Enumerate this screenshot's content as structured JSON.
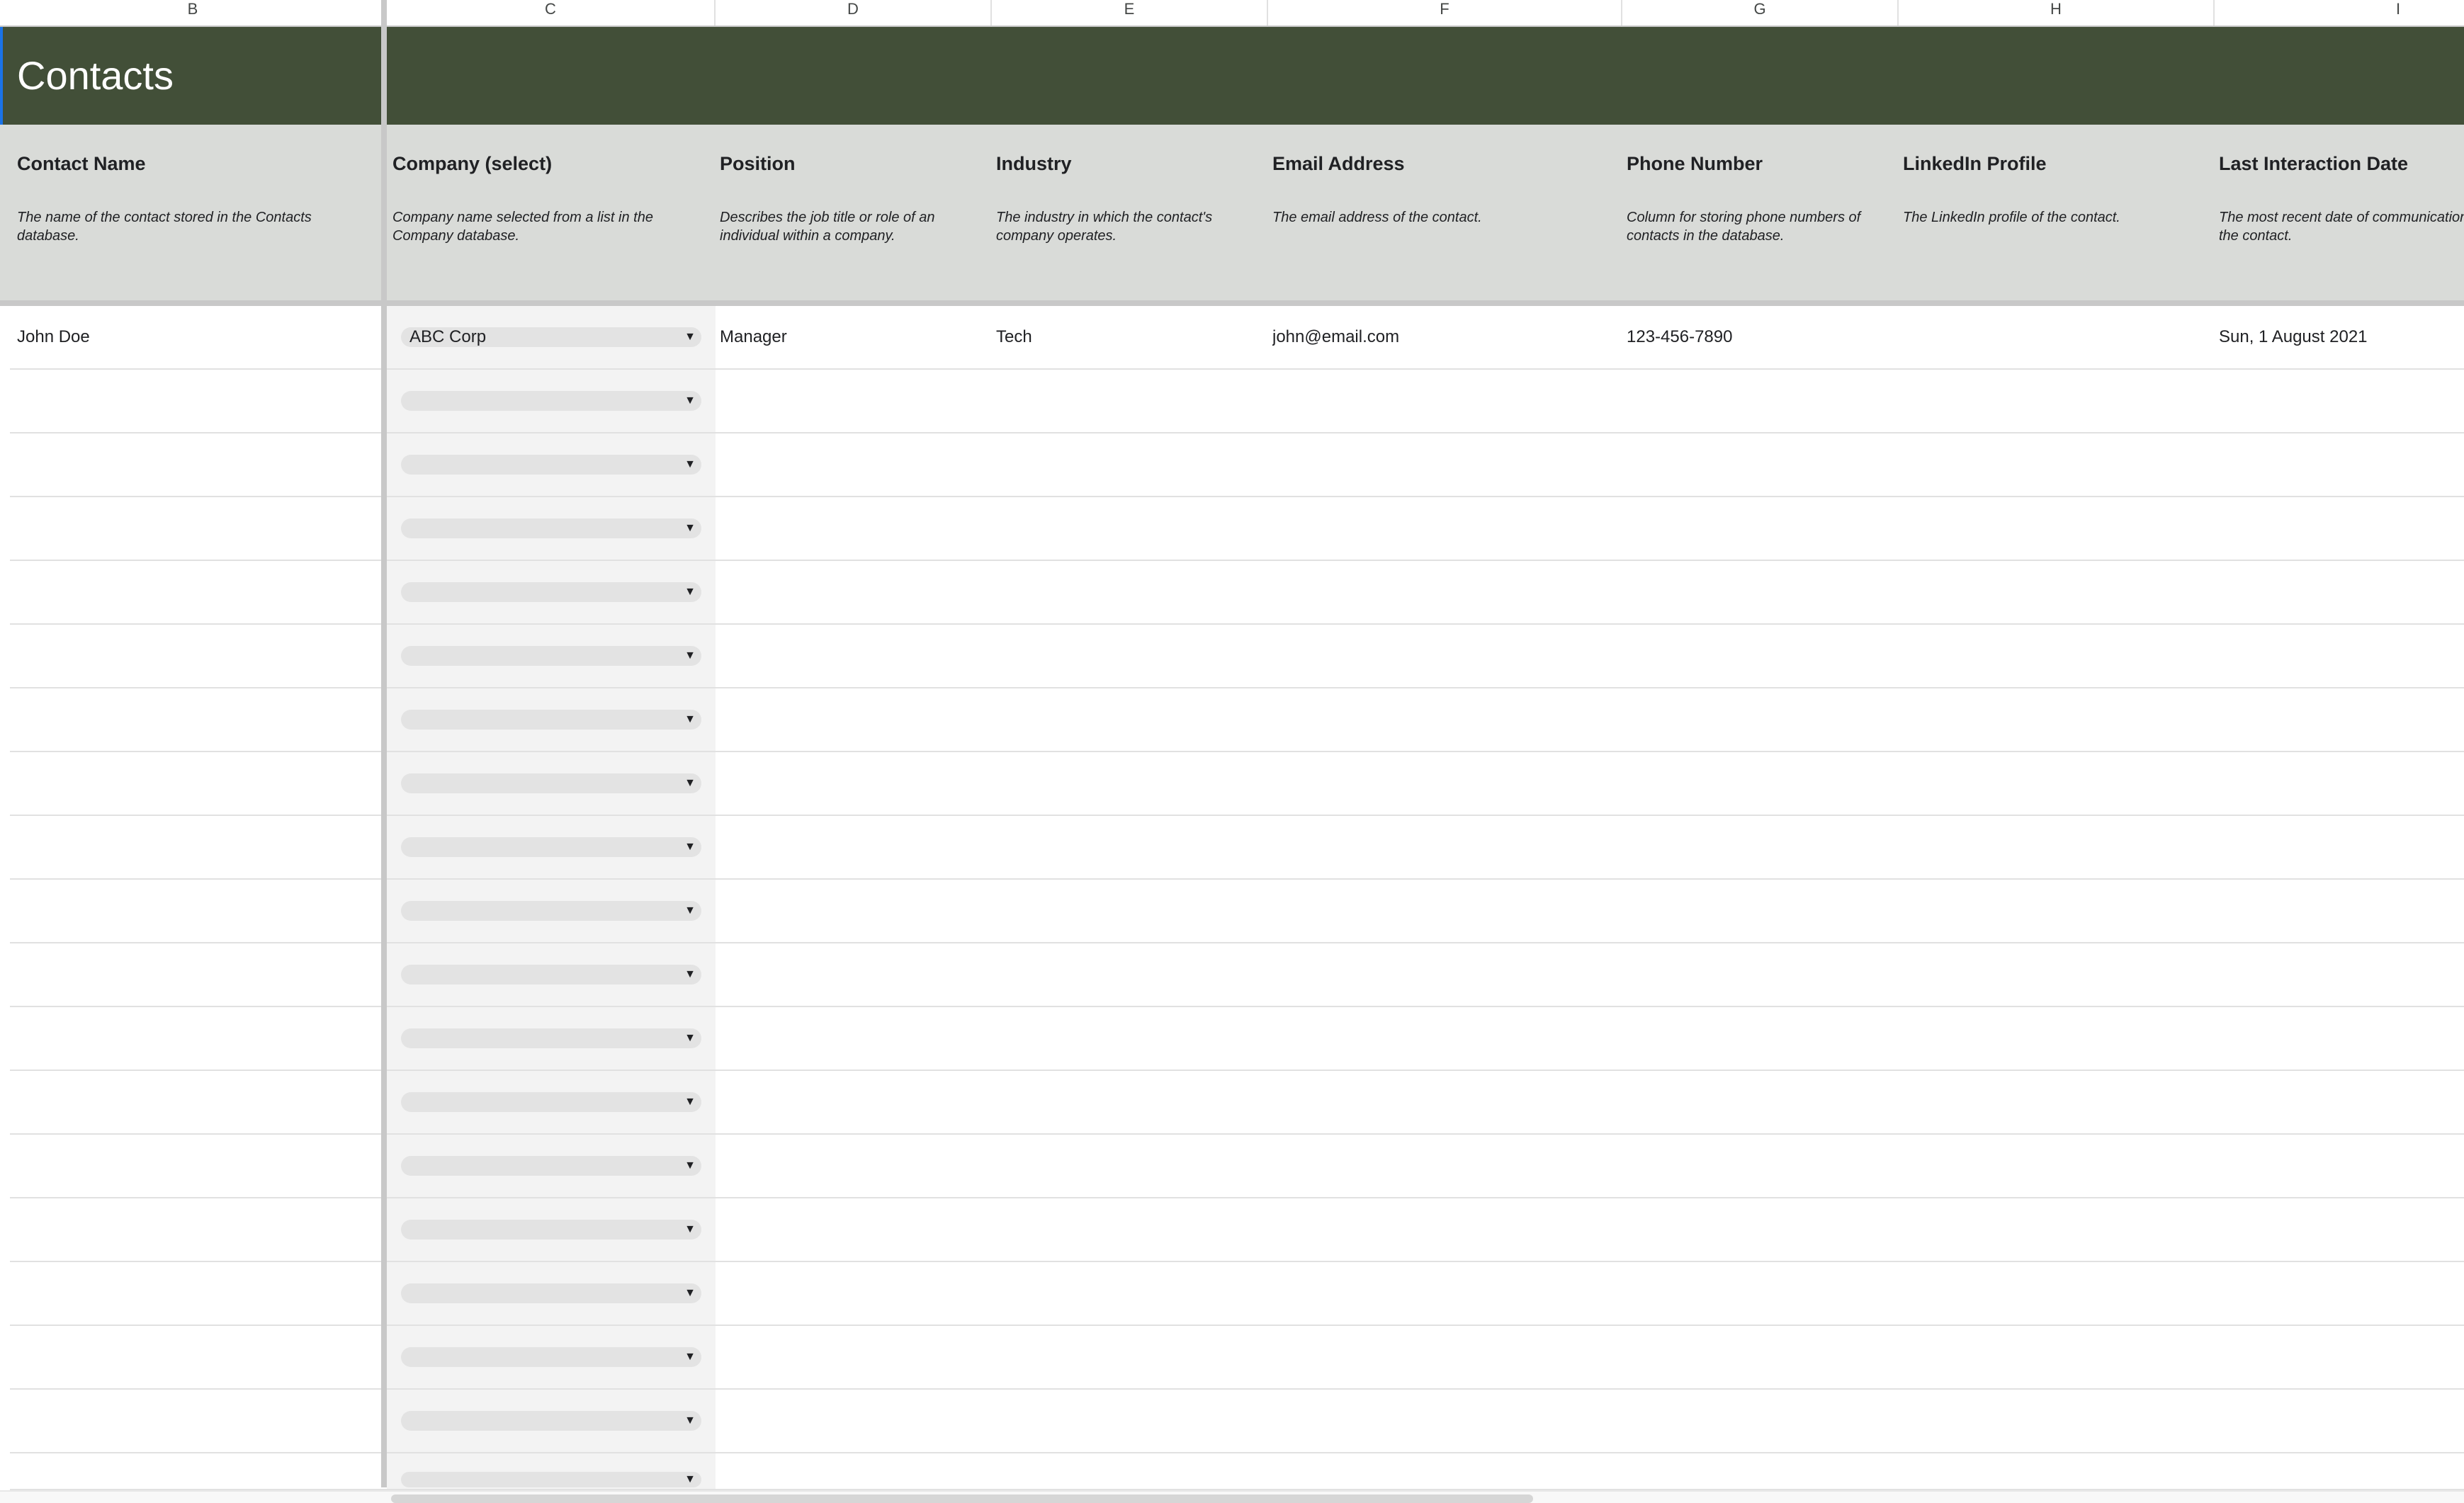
{
  "columns": [
    "B",
    "C",
    "D",
    "E",
    "F",
    "G",
    "H",
    "I"
  ],
  "title": "Contacts",
  "fields": [
    {
      "name": "Contact Name",
      "description": "The name of the contact stored in the Contacts database."
    },
    {
      "name": "Company (select)",
      "description": "Company name selected from a list in the Company database."
    },
    {
      "name": "Position",
      "description": "Describes the job title or role of an individual within a company."
    },
    {
      "name": "Industry",
      "description": "The industry in which the contact's company operates."
    },
    {
      "name": "Email Address",
      "description": "The email address of the contact."
    },
    {
      "name": "Phone Number",
      "description": "Column for storing phone numbers of contacts in the database."
    },
    {
      "name": "LinkedIn Profile",
      "description": "The LinkedIn profile of the contact."
    },
    {
      "name": "Last Interaction Date",
      "description": "The most recent date of communication with the contact."
    }
  ],
  "rows": [
    {
      "contact_name": "John Doe",
      "company": "ABC Corp",
      "position": "Manager",
      "industry": "Tech",
      "email": "john@email.com",
      "phone": "123-456-7890",
      "linkedin": "",
      "last_interaction": "Sun, 1 August 2021"
    },
    {
      "contact_name": "",
      "company": "",
      "position": "",
      "industry": "",
      "email": "",
      "phone": "",
      "linkedin": "",
      "last_interaction": ""
    },
    {
      "contact_name": "",
      "company": "",
      "position": "",
      "industry": "",
      "email": "",
      "phone": "",
      "linkedin": "",
      "last_interaction": ""
    },
    {
      "contact_name": "",
      "company": "",
      "position": "",
      "industry": "",
      "email": "",
      "phone": "",
      "linkedin": "",
      "last_interaction": ""
    },
    {
      "contact_name": "",
      "company": "",
      "position": "",
      "industry": "",
      "email": "",
      "phone": "",
      "linkedin": "",
      "last_interaction": ""
    },
    {
      "contact_name": "",
      "company": "",
      "position": "",
      "industry": "",
      "email": "",
      "phone": "",
      "linkedin": "",
      "last_interaction": ""
    },
    {
      "contact_name": "",
      "company": "",
      "position": "",
      "industry": "",
      "email": "",
      "phone": "",
      "linkedin": "",
      "last_interaction": ""
    },
    {
      "contact_name": "",
      "company": "",
      "position": "",
      "industry": "",
      "email": "",
      "phone": "",
      "linkedin": "",
      "last_interaction": ""
    },
    {
      "contact_name": "",
      "company": "",
      "position": "",
      "industry": "",
      "email": "",
      "phone": "",
      "linkedin": "",
      "last_interaction": ""
    },
    {
      "contact_name": "",
      "company": "",
      "position": "",
      "industry": "",
      "email": "",
      "phone": "",
      "linkedin": "",
      "last_interaction": ""
    },
    {
      "contact_name": "",
      "company": "",
      "position": "",
      "industry": "",
      "email": "",
      "phone": "",
      "linkedin": "",
      "last_interaction": ""
    },
    {
      "contact_name": "",
      "company": "",
      "position": "",
      "industry": "",
      "email": "",
      "phone": "",
      "linkedin": "",
      "last_interaction": ""
    },
    {
      "contact_name": "",
      "company": "",
      "position": "",
      "industry": "",
      "email": "",
      "phone": "",
      "linkedin": "",
      "last_interaction": ""
    },
    {
      "contact_name": "",
      "company": "",
      "position": "",
      "industry": "",
      "email": "",
      "phone": "",
      "linkedin": "",
      "last_interaction": ""
    },
    {
      "contact_name": "",
      "company": "",
      "position": "",
      "industry": "",
      "email": "",
      "phone": "",
      "linkedin": "",
      "last_interaction": ""
    },
    {
      "contact_name": "",
      "company": "",
      "position": "",
      "industry": "",
      "email": "",
      "phone": "",
      "linkedin": "",
      "last_interaction": ""
    },
    {
      "contact_name": "",
      "company": "",
      "position": "",
      "industry": "",
      "email": "",
      "phone": "",
      "linkedin": "",
      "last_interaction": ""
    },
    {
      "contact_name": "",
      "company": "",
      "position": "",
      "industry": "",
      "email": "",
      "phone": "",
      "linkedin": "",
      "last_interaction": ""
    },
    {
      "contact_name": "",
      "company": "",
      "position": "",
      "industry": "",
      "email": "",
      "phone": "",
      "linkedin": "",
      "last_interaction": ""
    }
  ],
  "icons": {
    "dropdown": "dropdown-arrow-icon"
  },
  "colors": {
    "banner": "#424f38",
    "header_band": "#d9dbd8",
    "title_text": "#ffffff",
    "selection": "#1a73e8"
  }
}
